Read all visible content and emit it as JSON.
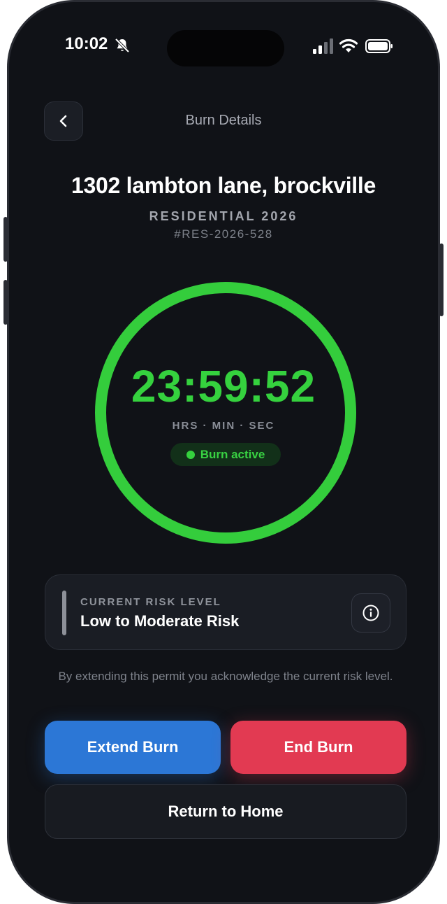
{
  "status_bar": {
    "time": "10:02"
  },
  "header": {
    "title": "Burn Details"
  },
  "permit": {
    "address": "1302 lambton lane, brockville",
    "category": "RESIDENTIAL 2026",
    "id": "#RES-2026-528"
  },
  "timer": {
    "value": "23:59:52",
    "units": "HRS · MIN · SEC",
    "status": "Burn active"
  },
  "risk": {
    "label": "CURRENT RISK LEVEL",
    "value": "Low to Moderate Risk"
  },
  "disclaimer": "By extending this permit you acknowledge the current risk level.",
  "actions": {
    "extend_label": "Extend Burn",
    "end_label": "End Burn",
    "home_label": "Return to Home"
  },
  "colors": {
    "accent_green": "#34cd3c",
    "extend_blue": "#2c77d6",
    "end_red": "#e23a52",
    "background": "#101217"
  },
  "icons": [
    "back-chevron-icon",
    "bell-slash-icon",
    "cellular-signal-icon",
    "wifi-icon",
    "battery-icon",
    "info-icon"
  ]
}
